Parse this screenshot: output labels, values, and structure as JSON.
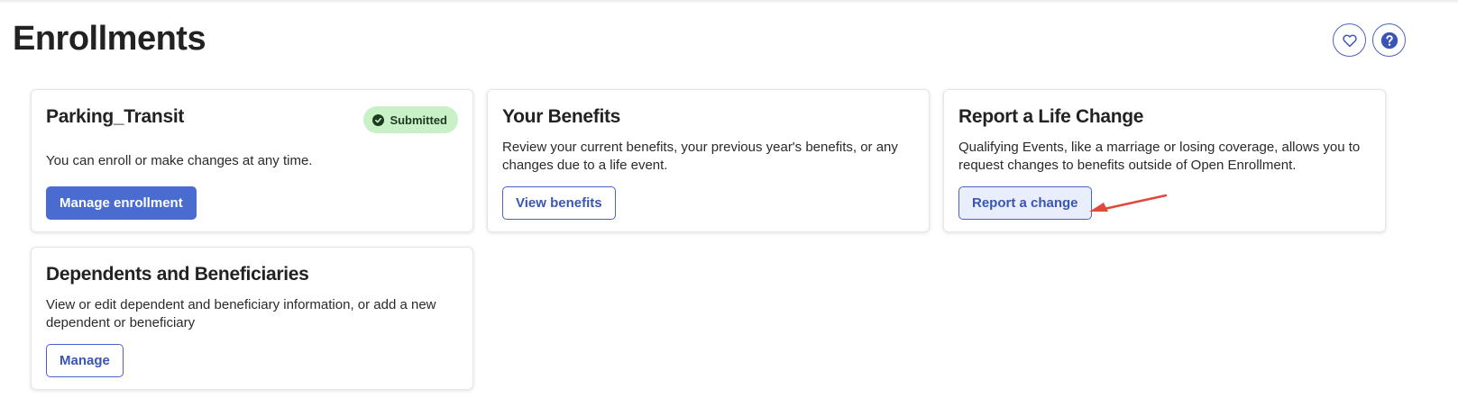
{
  "page": {
    "title": "Enrollments"
  },
  "header_actions": {
    "favorite_icon": "heart-icon",
    "help_icon": "question-circle-icon",
    "accent_color": "#4a62c4"
  },
  "cards": {
    "parking": {
      "title": "Parking_Transit",
      "badge": "Submitted",
      "badge_color": "#c8f1c8",
      "description": "You can enroll or make changes at any time.",
      "button_label": "Manage enrollment"
    },
    "benefits": {
      "title": "Your Benefits",
      "description_line1": "Review your current benefits, your previous year's benefits, or any",
      "description_line2": "changes due to a life event.",
      "button_label": "View benefits"
    },
    "life_change": {
      "title": "Report a Life Change",
      "description_line1": "Qualifying Events, like a marriage or losing coverage, allows you to",
      "description_line2": "request changes to benefits outside of Open Enrollment.",
      "button_label": "Report a change"
    },
    "dependents": {
      "title": "Dependents and Beneficiaries",
      "description_line1": "View or edit dependent and beneficiary information, or add a new",
      "description_line2": "dependent or beneficiary",
      "button_label": "Manage"
    }
  },
  "annotation": {
    "arrow_color": "#e0493b"
  }
}
